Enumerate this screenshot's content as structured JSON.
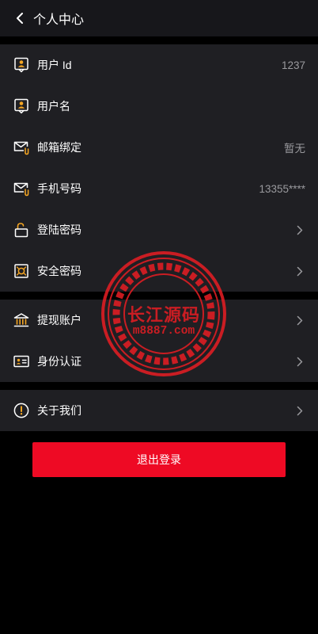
{
  "header": {
    "title": "个人中心",
    "back_icon": "chevron-left-icon"
  },
  "account_group": [
    {
      "name": "user-id",
      "label": "用户 Id",
      "value": "1237",
      "icon": "user-badge-icon",
      "chevron": false
    },
    {
      "name": "username",
      "label": "用户名",
      "value": "",
      "icon": "user-badge-icon",
      "chevron": false
    },
    {
      "name": "email-binding",
      "label": "邮箱绑定",
      "value": "暂无",
      "icon": "mail-clip-icon",
      "chevron": false
    },
    {
      "name": "phone-number",
      "label": "手机号码",
      "value": "13355****",
      "icon": "mail-clip-icon",
      "chevron": false
    },
    {
      "name": "login-password",
      "label": "登陆密码",
      "value": "",
      "icon": "unlock-icon",
      "chevron": true
    },
    {
      "name": "security-password",
      "label": "安全密码",
      "value": "",
      "icon": "safe-icon",
      "chevron": true
    }
  ],
  "finance_group": [
    {
      "name": "withdrawal-account",
      "label": "提现账户",
      "icon": "bank-icon",
      "chevron": true
    },
    {
      "name": "identity-verification",
      "label": "身份认证",
      "icon": "id-card-icon",
      "chevron": true
    }
  ],
  "about_group": [
    {
      "name": "about-us",
      "label": "关于我们",
      "icon": "info-icon",
      "chevron": true
    }
  ],
  "logout_label": "退出登录",
  "watermark": {
    "cn": "长江源码",
    "url": "m8887.com"
  },
  "colors": {
    "accent": "#ee0a24",
    "icon_orange": "#f5a623",
    "background": "#000000",
    "panel": "#1f1f23",
    "watermark": "#e21d23"
  }
}
